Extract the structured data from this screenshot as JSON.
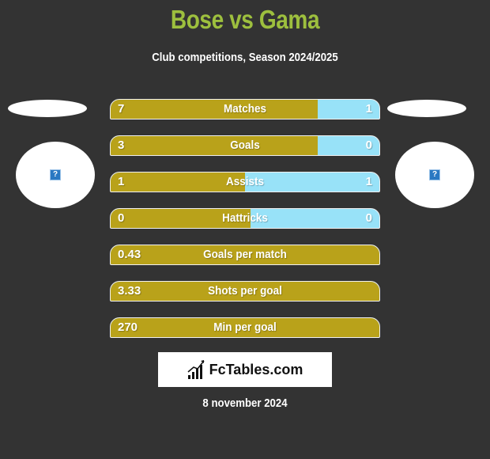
{
  "header": {
    "title": "Bose vs Gama",
    "subtitle": "Club competitions, Season 2024/2025"
  },
  "teams": {
    "left": {
      "name": "Bose",
      "logo_icon": "missing-image-icon",
      "logo_glyph": "?"
    },
    "right": {
      "name": "Gama",
      "logo_icon": "missing-image-icon",
      "logo_glyph": "?"
    }
  },
  "colors": {
    "background": "#333333",
    "title": "#9dbf3e",
    "left_bar": "#b9a21a",
    "right_bar": "#98e2f8"
  },
  "stats": [
    {
      "label": "Matches",
      "left": "7",
      "right": "1",
      "left_share": 0.77
    },
    {
      "label": "Goals",
      "left": "3",
      "right": "0",
      "left_share": 0.77
    },
    {
      "label": "Assists",
      "left": "1",
      "right": "1",
      "left_share": 0.5
    },
    {
      "label": "Hattricks",
      "left": "0",
      "right": "0",
      "left_share": 0.52
    },
    {
      "label": "Goals per match",
      "left": "0.43",
      "right": "",
      "left_share": 1
    },
    {
      "label": "Shots per goal",
      "left": "3.33",
      "right": "",
      "left_share": 1
    },
    {
      "label": "Min per goal",
      "left": "270",
      "right": "",
      "left_share": 1
    }
  ],
  "footer": {
    "brand": "FcTables.com",
    "date": "8 november 2024"
  }
}
